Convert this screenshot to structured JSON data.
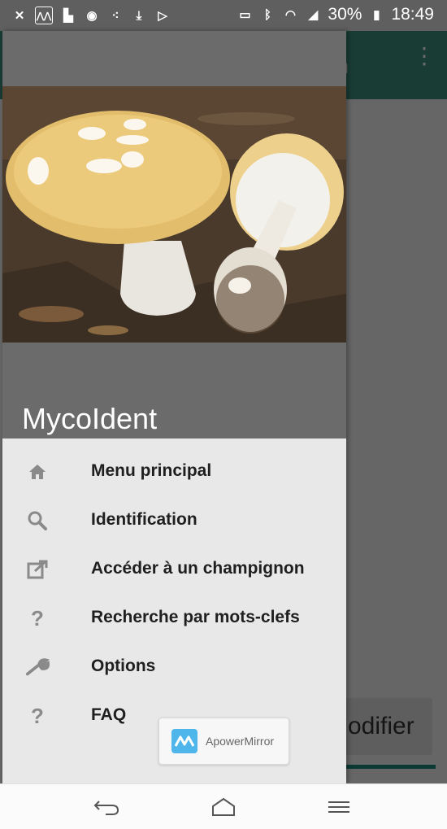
{
  "status_bar": {
    "battery": "30%",
    "time": "18:49"
  },
  "background_app": {
    "title_fragment": "on",
    "button_fragment": "odifier"
  },
  "drawer": {
    "app_name": "MycoIdent",
    "menu": [
      {
        "label": "Menu principal",
        "icon": "home-icon"
      },
      {
        "label": "Identification",
        "icon": "search-icon"
      },
      {
        "label": "Accéder à un champignon",
        "icon": "open-external-icon"
      },
      {
        "label": "Recherche par mots-clefs",
        "icon": "question-icon"
      },
      {
        "label": "Options",
        "icon": "wrench-icon"
      },
      {
        "label": "FAQ",
        "icon": "question-icon"
      }
    ]
  },
  "overlay": {
    "label": "ApowerMirror"
  },
  "colors": {
    "accent": "#3c8f7d",
    "scrim": "#000000",
    "drawer_bg": "#e8e8e8"
  }
}
